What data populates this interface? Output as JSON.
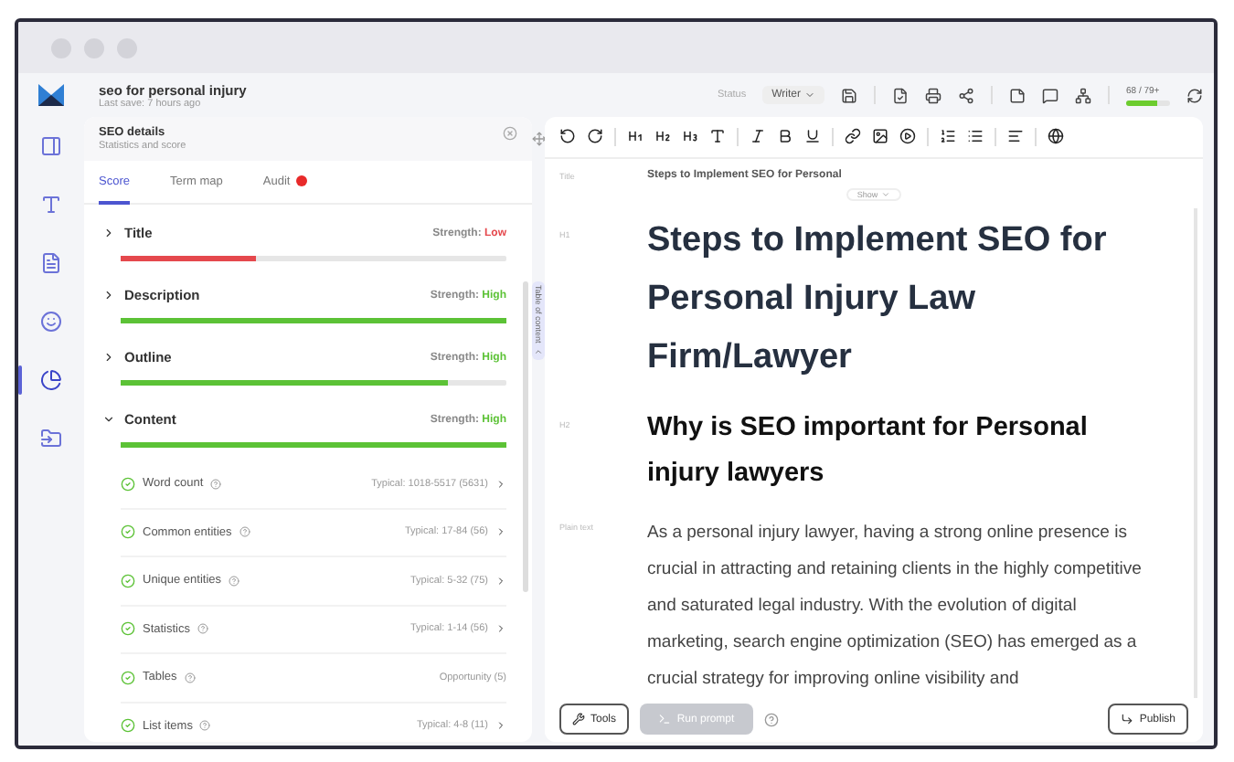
{
  "document": {
    "title": "seo for personal injury",
    "last_save_label": "Last save:",
    "last_save": "7 hours ago"
  },
  "rail_items": [
    {
      "selected": false
    },
    {
      "selected": false
    },
    {
      "selected": false
    },
    {
      "selected": false
    },
    {
      "selected": true
    },
    {
      "selected": false
    }
  ],
  "header": {
    "status_label": "Status",
    "status": "Writer",
    "score": "68",
    "score_target": "/ 79+",
    "score_meter": {
      "level": 0.7
    }
  },
  "panel": {
    "title": "SEO details",
    "subtitle": "Statistics and score",
    "tabs": [
      {
        "label": "Score",
        "selected": true,
        "alert": false
      },
      {
        "label": "Term map",
        "selected": false,
        "alert": false
      },
      {
        "label": "Audit",
        "selected": false,
        "alert": true
      }
    ],
    "sections": [
      {
        "name": "Title",
        "strength_label": "Strength:",
        "strength": "Low",
        "kind": "low",
        "level": 0.35,
        "expanded": false
      },
      {
        "name": "Description",
        "strength_label": "Strength:",
        "strength": "High",
        "kind": "high",
        "level": 1,
        "expanded": false
      },
      {
        "name": "Outline",
        "strength_label": "Strength:",
        "strength": "High",
        "kind": "high",
        "level": 0.85,
        "expanded": false
      },
      {
        "name": "Content",
        "strength_label": "Strength:",
        "strength": "High",
        "kind": "high",
        "level": 1,
        "expanded": true
      }
    ],
    "content_items": [
      {
        "name": "Word count",
        "value": "Typical: 1018-5517 (5631)",
        "arrow": true
      },
      {
        "name": "Common entities",
        "value": "Typical: 17-84 (56)",
        "arrow": true
      },
      {
        "name": "Unique entities",
        "value": "Typical: 5-32 (75)",
        "arrow": true
      },
      {
        "name": "Statistics",
        "value": "Typical: 1-14 (56)",
        "arrow": true
      },
      {
        "name": "Tables",
        "value": "Opportunity (5)",
        "arrow": false
      },
      {
        "name": "List items",
        "value": "Typical: 4-8 (11)",
        "arrow": true
      }
    ]
  },
  "toc_tab": "Table of content",
  "editor": {
    "title_label": "Title",
    "title_value": "Steps to Implement SEO for Personal",
    "show_button": "Show",
    "blocks": [
      {
        "kind": "h1",
        "tag": "H1",
        "text": "Steps to Implement SEO for Personal Injury Law Firm/Lawyer"
      },
      {
        "kind": "h2",
        "tag": "H2",
        "text": "Why is SEO important for Personal injury lawyers"
      },
      {
        "kind": "p",
        "tag": "Plain text",
        "text": "As a personal injury lawyer, having a strong online presence is crucial in attracting and retaining clients in the highly competitive and saturated legal industry. With the evolution of digital marketing, search engine optimization (SEO) has emerged as a crucial strategy for improving online visibility and"
      }
    ],
    "tools_button": "Tools",
    "run_prompt_button": "Run prompt",
    "run_prompt_disabled": true,
    "publish_button": "Publish"
  }
}
